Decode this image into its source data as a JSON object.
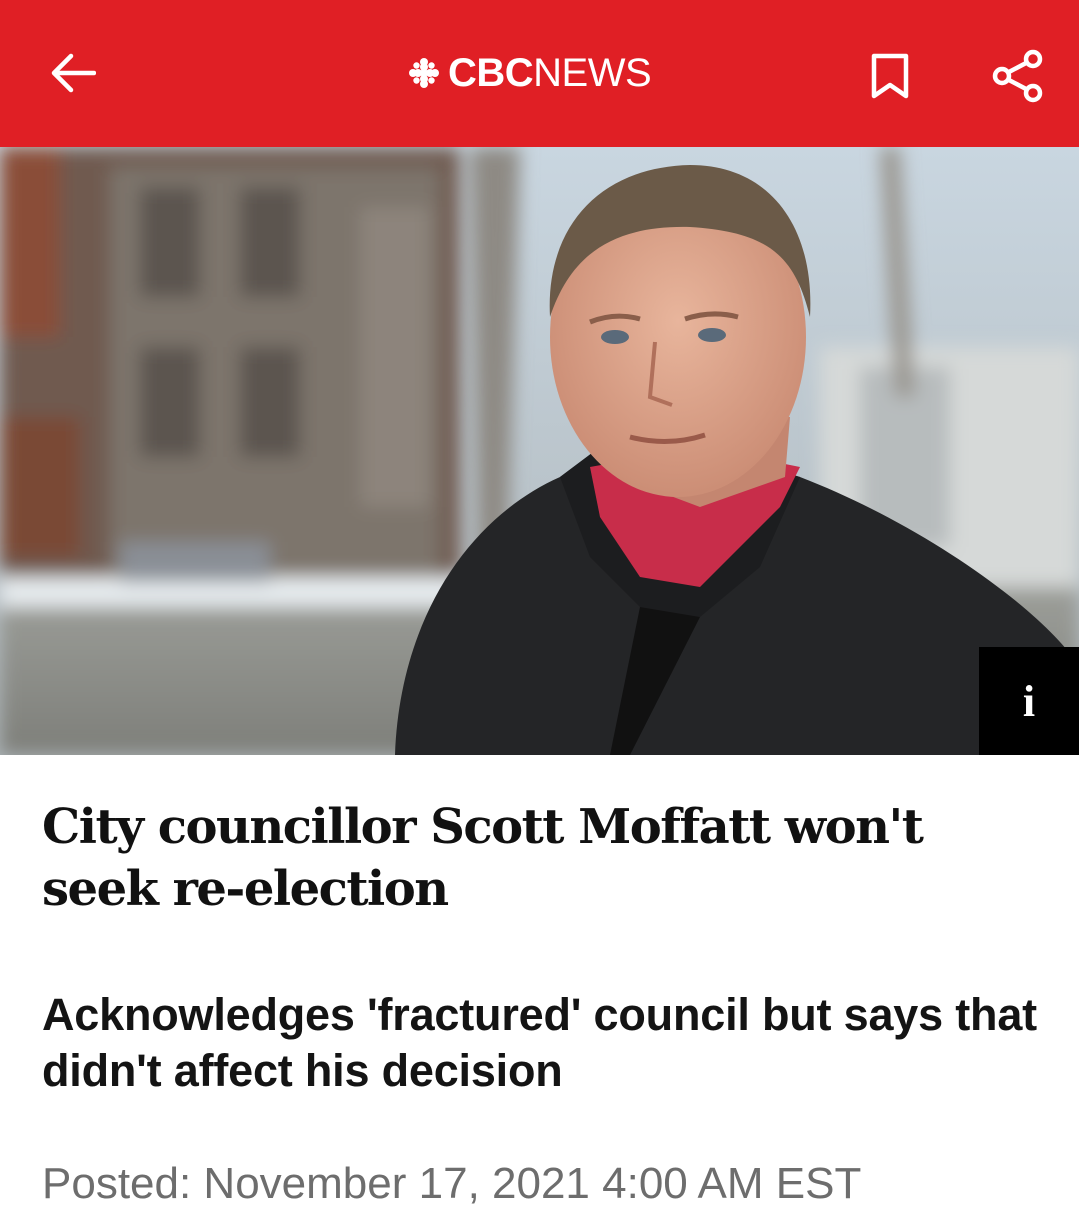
{
  "header": {
    "logo_cbc": "CBC",
    "logo_news": "NEWS",
    "background_color": "#e01f25",
    "back_icon": "arrow-left-icon",
    "bookmark_icon": "bookmark-icon",
    "share_icon": "share-icon"
  },
  "hero": {
    "info_label": "i"
  },
  "article": {
    "headline": "City councillor Scott Moffatt won't seek re-election",
    "deck": "Acknowledges 'fractured' council but says that didn't affect his decision",
    "posted": "Posted: November 17, 2021 4:00 AM EST"
  }
}
